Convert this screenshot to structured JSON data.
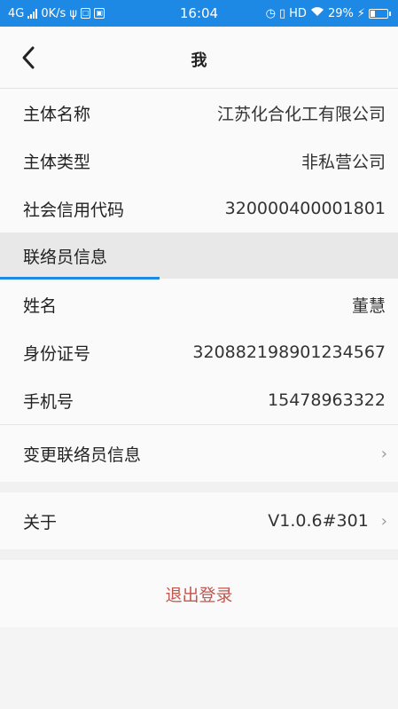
{
  "status_bar": {
    "network": "4G",
    "speed": "0K/s",
    "time": "16:04",
    "hd": "HD",
    "battery": "29%"
  },
  "nav": {
    "title": "我"
  },
  "entity": {
    "rows": [
      {
        "label": "主体名称",
        "value": "江苏化合化工有限公司"
      },
      {
        "label": "主体类型",
        "value": "非私营公司"
      },
      {
        "label": "社会信用代码",
        "value": "320000400001801"
      }
    ]
  },
  "contact": {
    "header": "联络员信息",
    "rows": [
      {
        "label": "姓名",
        "value": "董慧"
      },
      {
        "label": "身份证号",
        "value": "320882198901234567"
      },
      {
        "label": "手机号",
        "value": "15478963322"
      }
    ],
    "change_label": "变更联络员信息"
  },
  "about": {
    "label": "关于",
    "version": "V1.0.6#301"
  },
  "logout_label": "退出登录",
  "colors": {
    "status_bar": "#1e88e5",
    "accent": "#1e88e5",
    "logout": "#c0574e"
  }
}
